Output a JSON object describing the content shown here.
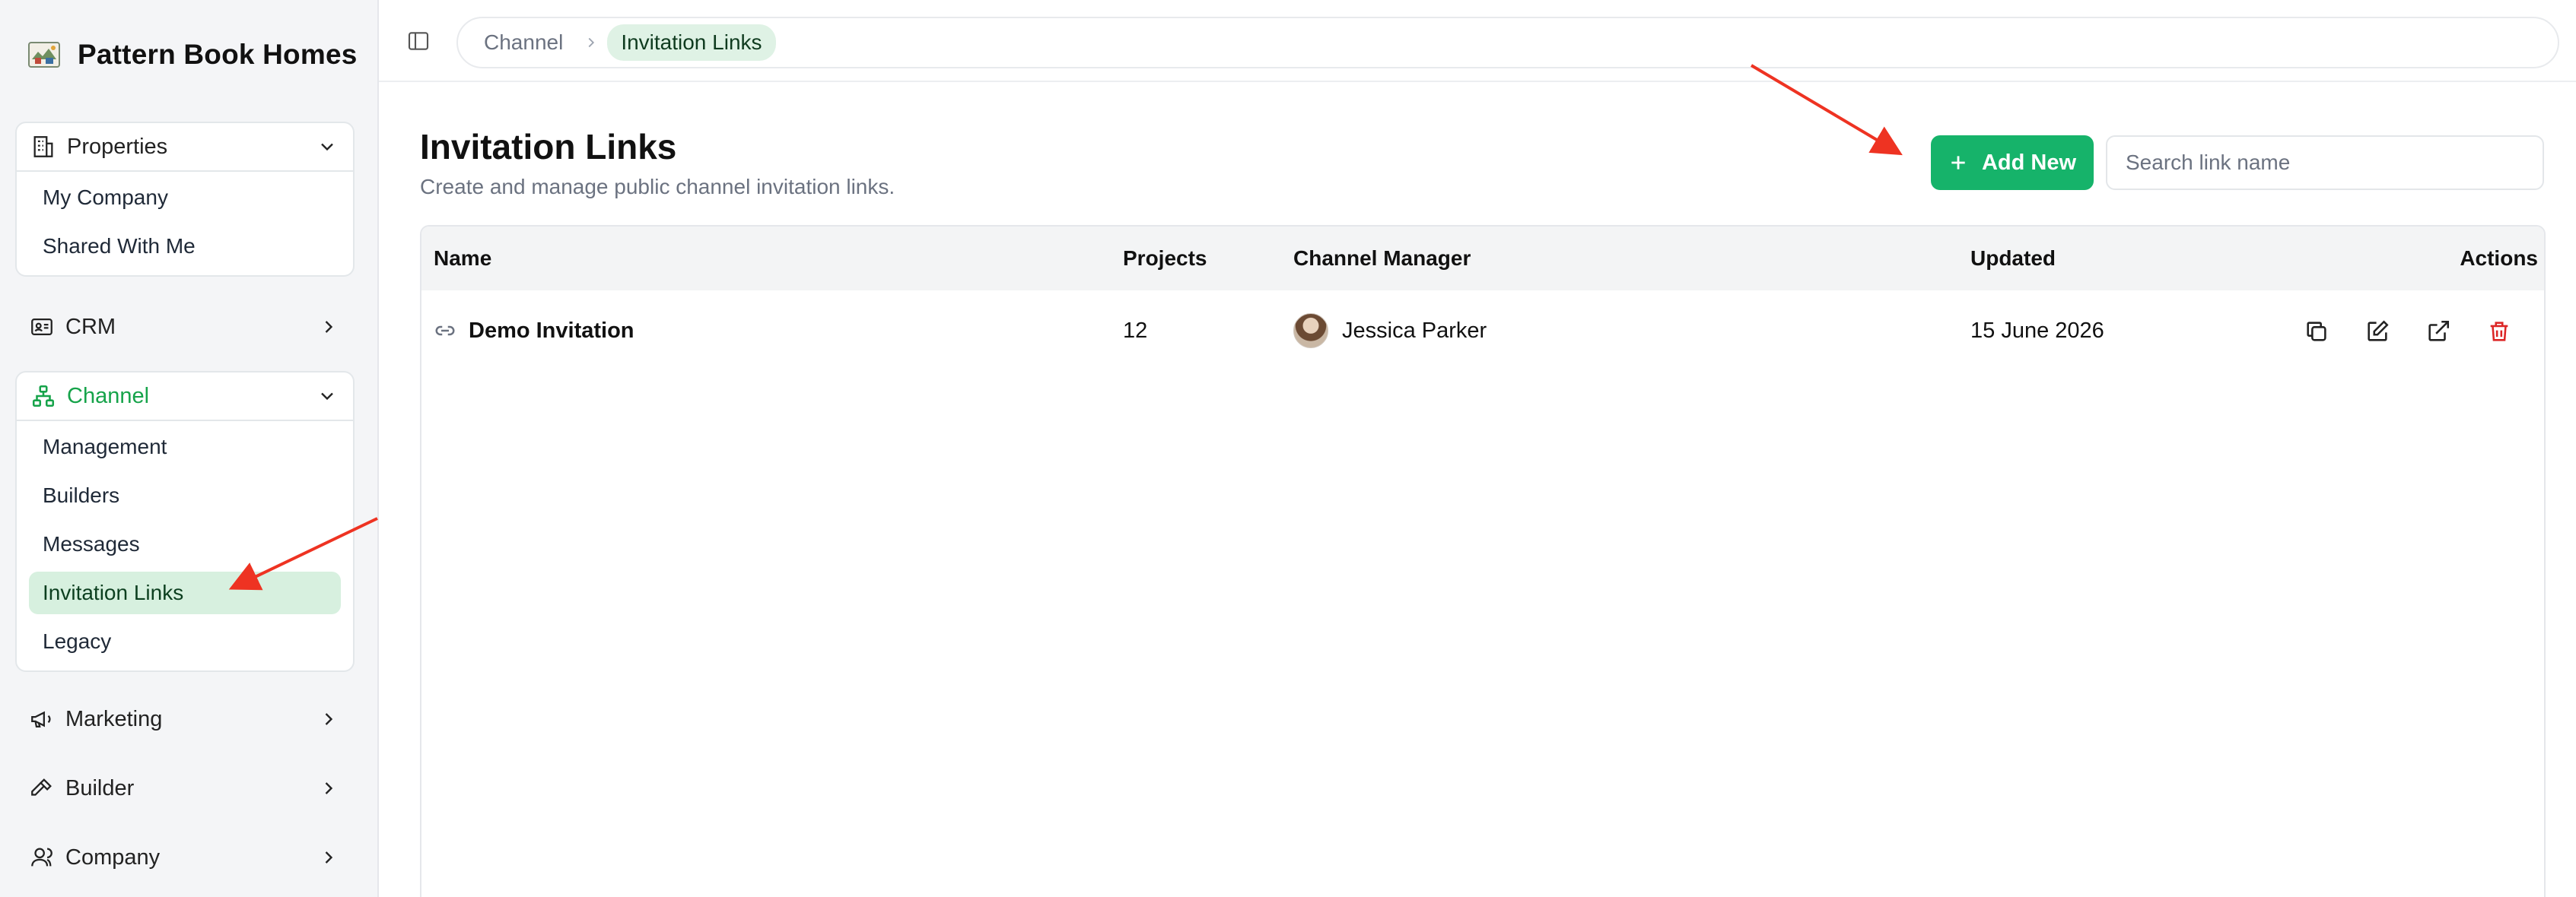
{
  "brand": {
    "name": "Pattern Book Homes"
  },
  "sidebar": {
    "properties": {
      "label": "Properties",
      "items": [
        "My Company",
        "Shared With Me"
      ]
    },
    "crm": {
      "label": "CRM"
    },
    "channel": {
      "label": "Channel",
      "items": [
        "Management",
        "Builders",
        "Messages",
        "Invitation Links",
        "Legacy"
      ],
      "active": "Invitation Links"
    },
    "marketing": {
      "label": "Marketing"
    },
    "builder": {
      "label": "Builder"
    },
    "company": {
      "label": "Company"
    }
  },
  "breadcrumb": {
    "parent": "Channel",
    "current": "Invitation Links"
  },
  "page": {
    "title": "Invitation Links",
    "subtitle": "Create and manage public channel invitation links."
  },
  "toolbar": {
    "add_label": "Add New",
    "search_placeholder": "Search link name"
  },
  "table": {
    "columns": {
      "name": "Name",
      "projects": "Projects",
      "manager": "Channel Manager",
      "updated": "Updated",
      "actions": "Actions"
    },
    "rows": [
      {
        "name": "Demo Invitation",
        "projects": "12",
        "manager": "Jessica Parker",
        "updated": "15 June 2026"
      }
    ]
  },
  "colors": {
    "accent": "#16b36a",
    "active_bg": "#d7f0df",
    "danger": "#dc2626",
    "annotation": "#ee3322"
  },
  "icons": [
    "app-logo-icon",
    "building-icon",
    "id-card-icon",
    "sitemap-icon",
    "megaphone-icon",
    "hammer-icon",
    "user-icon",
    "sidebar-toggle-icon",
    "link-icon",
    "copy-icon",
    "edit-icon",
    "external-link-icon",
    "trash-icon"
  ]
}
